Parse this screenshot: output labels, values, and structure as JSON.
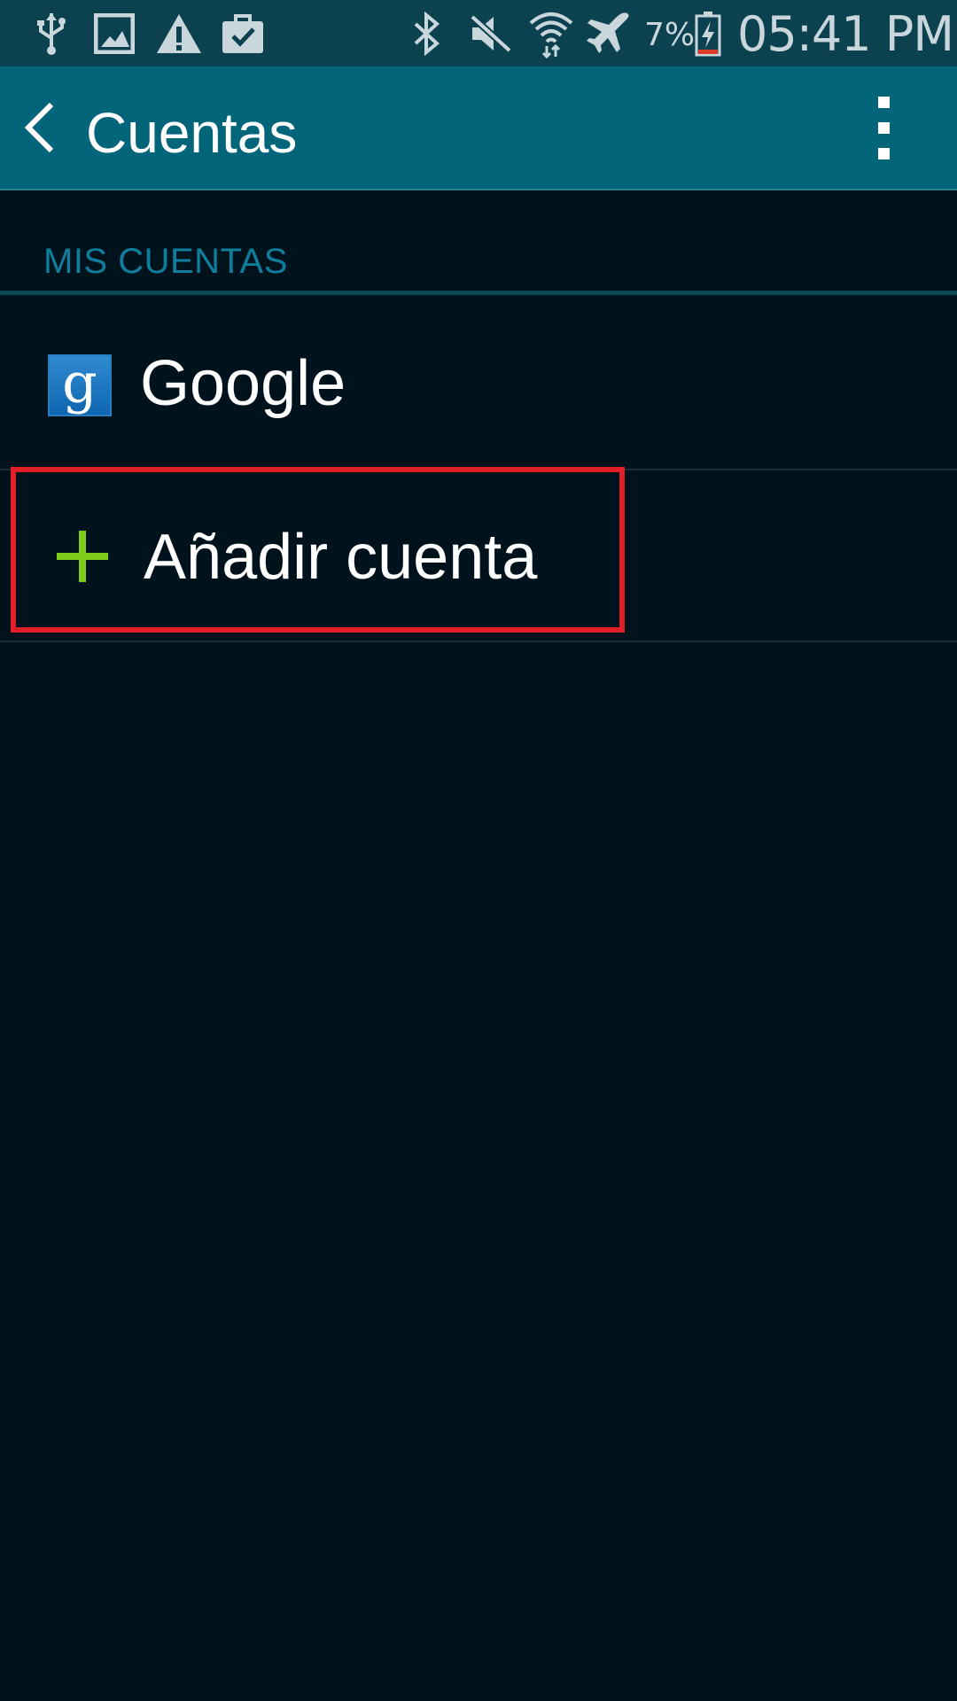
{
  "status_bar": {
    "left_icons": [
      "usb-icon",
      "gallery-icon",
      "warning-icon",
      "briefcase-check-icon"
    ],
    "right_icons": [
      "bluetooth-icon",
      "mute-icon",
      "wifi-icon",
      "airplane-icon",
      "battery-charging-icon"
    ],
    "battery_percent": "7%",
    "time": "05:41 PM"
  },
  "action_bar": {
    "back_icon": "chevron-left-icon",
    "title": "Cuentas",
    "overflow_icon": "more-vertical-icon"
  },
  "section": {
    "header": "MIS CUENTAS"
  },
  "accounts": [
    {
      "label": "Google",
      "icon": "google-icon",
      "icon_glyph": "g"
    }
  ],
  "add_account": {
    "label": "Añadir cuenta",
    "icon": "plus-icon"
  },
  "colors": {
    "status_bar_bg": "#0c4150",
    "action_bar_bg": "#02657a",
    "background": "#00131c",
    "section_header_text": "#0f7e9c",
    "plus_green": "#7fcc1a",
    "highlight_red": "#e01f28"
  }
}
